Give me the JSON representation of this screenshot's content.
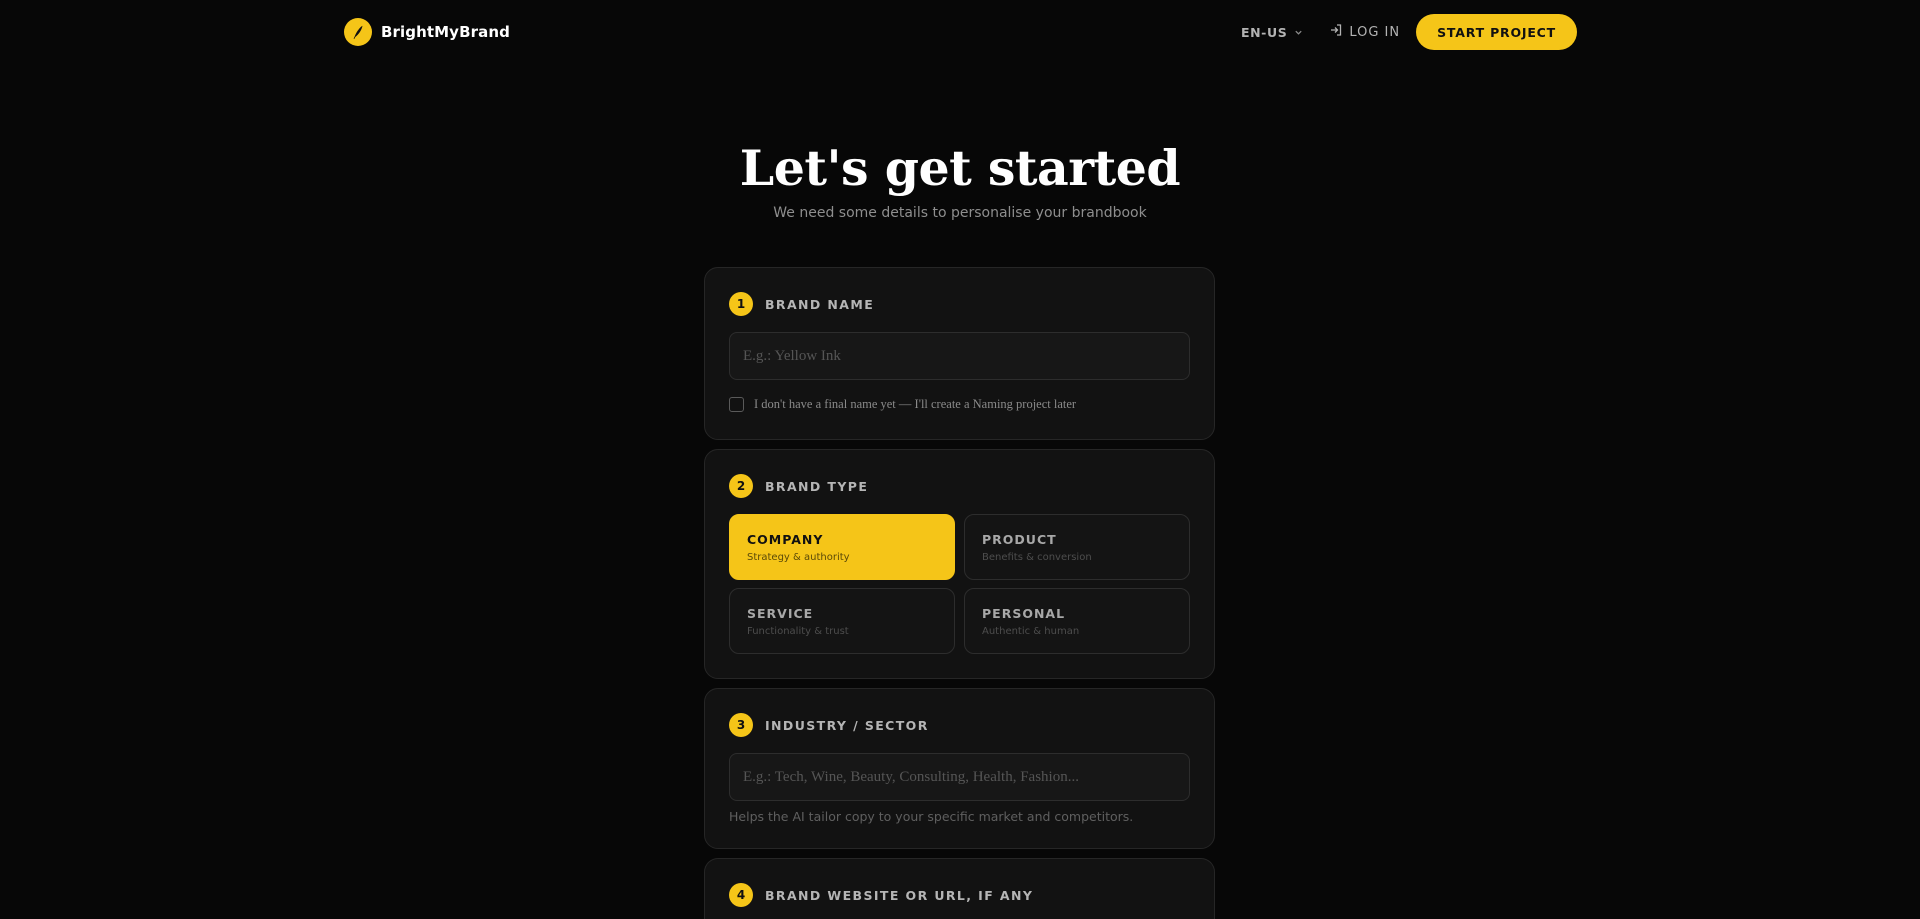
{
  "header": {
    "brand_name": "BrightMyBrand",
    "language": "EN-US",
    "login_label": "LOG IN",
    "cta_label": "START PROJECT"
  },
  "hero": {
    "title": "Let's get started",
    "subtitle": "We need some details to personalise your brandbook"
  },
  "steps": [
    {
      "number": "1",
      "title": "BRAND NAME",
      "placeholder": "E.g.: Yellow Ink",
      "value": "",
      "checkbox_label": "I don't have a final name yet — I'll create a Naming project later",
      "checkbox_checked": false
    },
    {
      "number": "2",
      "title": "BRAND TYPE",
      "selected": "COMPANY",
      "options": [
        {
          "name": "COMPANY",
          "desc": "Strategy & authority"
        },
        {
          "name": "PRODUCT",
          "desc": "Benefits & conversion"
        },
        {
          "name": "SERVICE",
          "desc": "Functionality & trust"
        },
        {
          "name": "PERSONAL",
          "desc": "Authentic & human"
        }
      ]
    },
    {
      "number": "3",
      "title": "INDUSTRY / SECTOR",
      "placeholder": "E.g.: Tech, Wine, Beauty, Consulting, Health, Fashion...",
      "value": "",
      "helper": "Helps the AI tailor copy to your specific market and competitors."
    },
    {
      "number": "4",
      "title": "BRAND WEBSITE OR URL, IF ANY"
    }
  ],
  "colors": {
    "accent": "#f5c518",
    "background": "#070707",
    "card": "#121212"
  }
}
